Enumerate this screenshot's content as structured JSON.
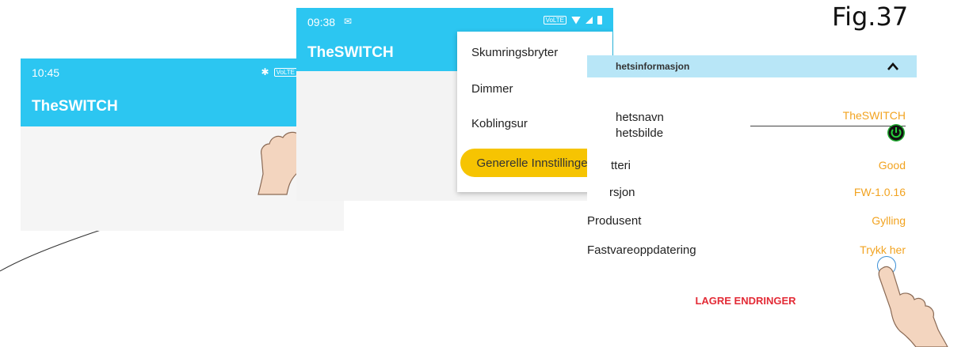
{
  "figure_label": "Fig.37",
  "screen1": {
    "status_time": "10:45",
    "status_volte": "VoLTE",
    "app_title": "TheSWITCH"
  },
  "screen2": {
    "status_time": "09:38",
    "status_volte": "VoLTE",
    "app_title": "TheSWITCH",
    "menu": {
      "items": [
        "Skumringsbryter",
        "Dimmer",
        "Koblingsur"
      ],
      "selected": "Generelle Innstillinger",
      "selected_color": "#f6c402"
    }
  },
  "screen3": {
    "section_title": "hetsinformasjon",
    "rows": [
      {
        "label": "hetsnavn",
        "value": "TheSWITCH"
      },
      {
        "label": "hetsbilde",
        "value": ""
      },
      {
        "label": "tteri",
        "value": "Good"
      },
      {
        "label": "rsjon",
        "value": "FW-1.0.16"
      },
      {
        "label": "Produsent",
        "value": "Gylling"
      },
      {
        "label": "Fastvareoppdatering",
        "value": "Trykk her"
      }
    ],
    "save_label": "LAGRE ENDRINGER",
    "accent_color": "#f2a320",
    "save_color": "#e32b36"
  },
  "colors": {
    "appbar": "#2cc6f1",
    "section_header": "#b8e6f7"
  }
}
